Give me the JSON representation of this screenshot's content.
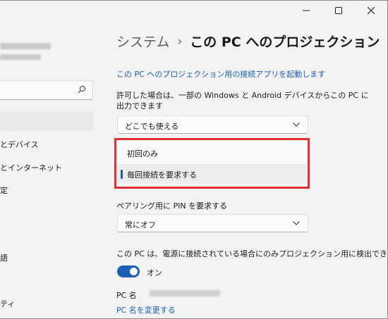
{
  "window": {
    "minimize_icon": "minimize-icon",
    "maximize_icon": "maximize-icon",
    "close_icon": "close-icon"
  },
  "sidebar": {
    "search_icon": "search-icon",
    "items": [
      {
        "label": "とデバイス"
      },
      {
        "label": "とインターネット"
      },
      {
        "label": "定"
      },
      {
        "label": "語"
      },
      {
        "label": "ティ"
      }
    ]
  },
  "header": {
    "parent": "システム",
    "separator": "›",
    "current": "この PC へのプロジェクション"
  },
  "main": {
    "launch_link": "この PC へのプロジェクション用の接続アプリを起動します",
    "allow_description": "許可した場合は、一部の Windows と Android デバイスからこの PC に出力できます",
    "allow_dropdown_value": "どこでも使える",
    "ask_options": [
      {
        "label": "初回のみ",
        "selected": false
      },
      {
        "label": "毎回接続を要求する",
        "selected": true
      }
    ],
    "pin_label": "ペアリング用に PIN を要求する",
    "pin_dropdown_value": "常にオフ",
    "power_label": "この PC は、電源に接続されている場合にのみプロジェクション用に検出できます",
    "power_toggle_state": "オン",
    "pc_name_label": "PC 名",
    "rename_link": "PC 名を変更する"
  },
  "colors": {
    "accent": "#1a5fb4",
    "highlight_box": "#e03030",
    "background": "#f3f3f3"
  }
}
